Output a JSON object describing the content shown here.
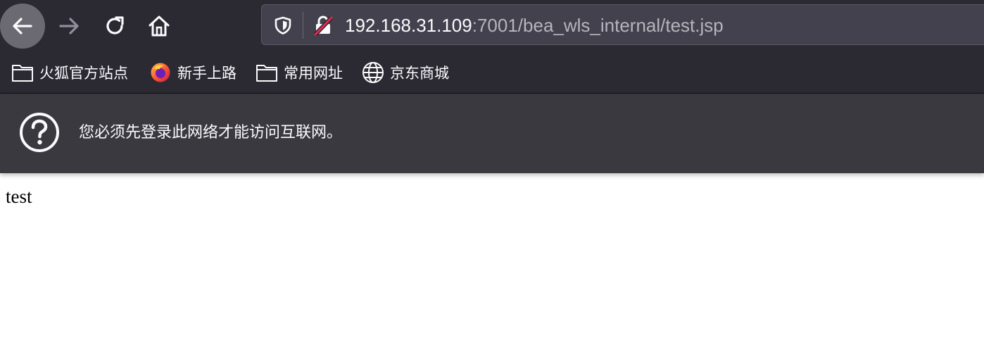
{
  "browser": {
    "url": {
      "host": "192.168.31.109",
      "rest": ":7001/bea_wls_internal/test.jsp"
    },
    "nav": {
      "back_icon": "arrow-left-icon",
      "forward_icon": "arrow-right-icon",
      "reload_icon": "reload-icon",
      "home_icon": "home-icon"
    },
    "bookmarks": [
      {
        "label": "火狐官方站点",
        "icon": "folder-icon"
      },
      {
        "label": "新手上路",
        "icon": "firefox-icon"
      },
      {
        "label": "常用网址",
        "icon": "folder-icon"
      },
      {
        "label": "京东商城",
        "icon": "globe-icon"
      }
    ],
    "infobar": {
      "message": "您必须先登录此网络才能访问互联网。",
      "icon": "question-circle-icon"
    },
    "colors": {
      "toolbar": "#2b2a33",
      "urlbar": "#42414d",
      "infobar": "#3a3940",
      "insecure_lock_slash": "#e22850"
    }
  },
  "page": {
    "body_text": "test"
  }
}
